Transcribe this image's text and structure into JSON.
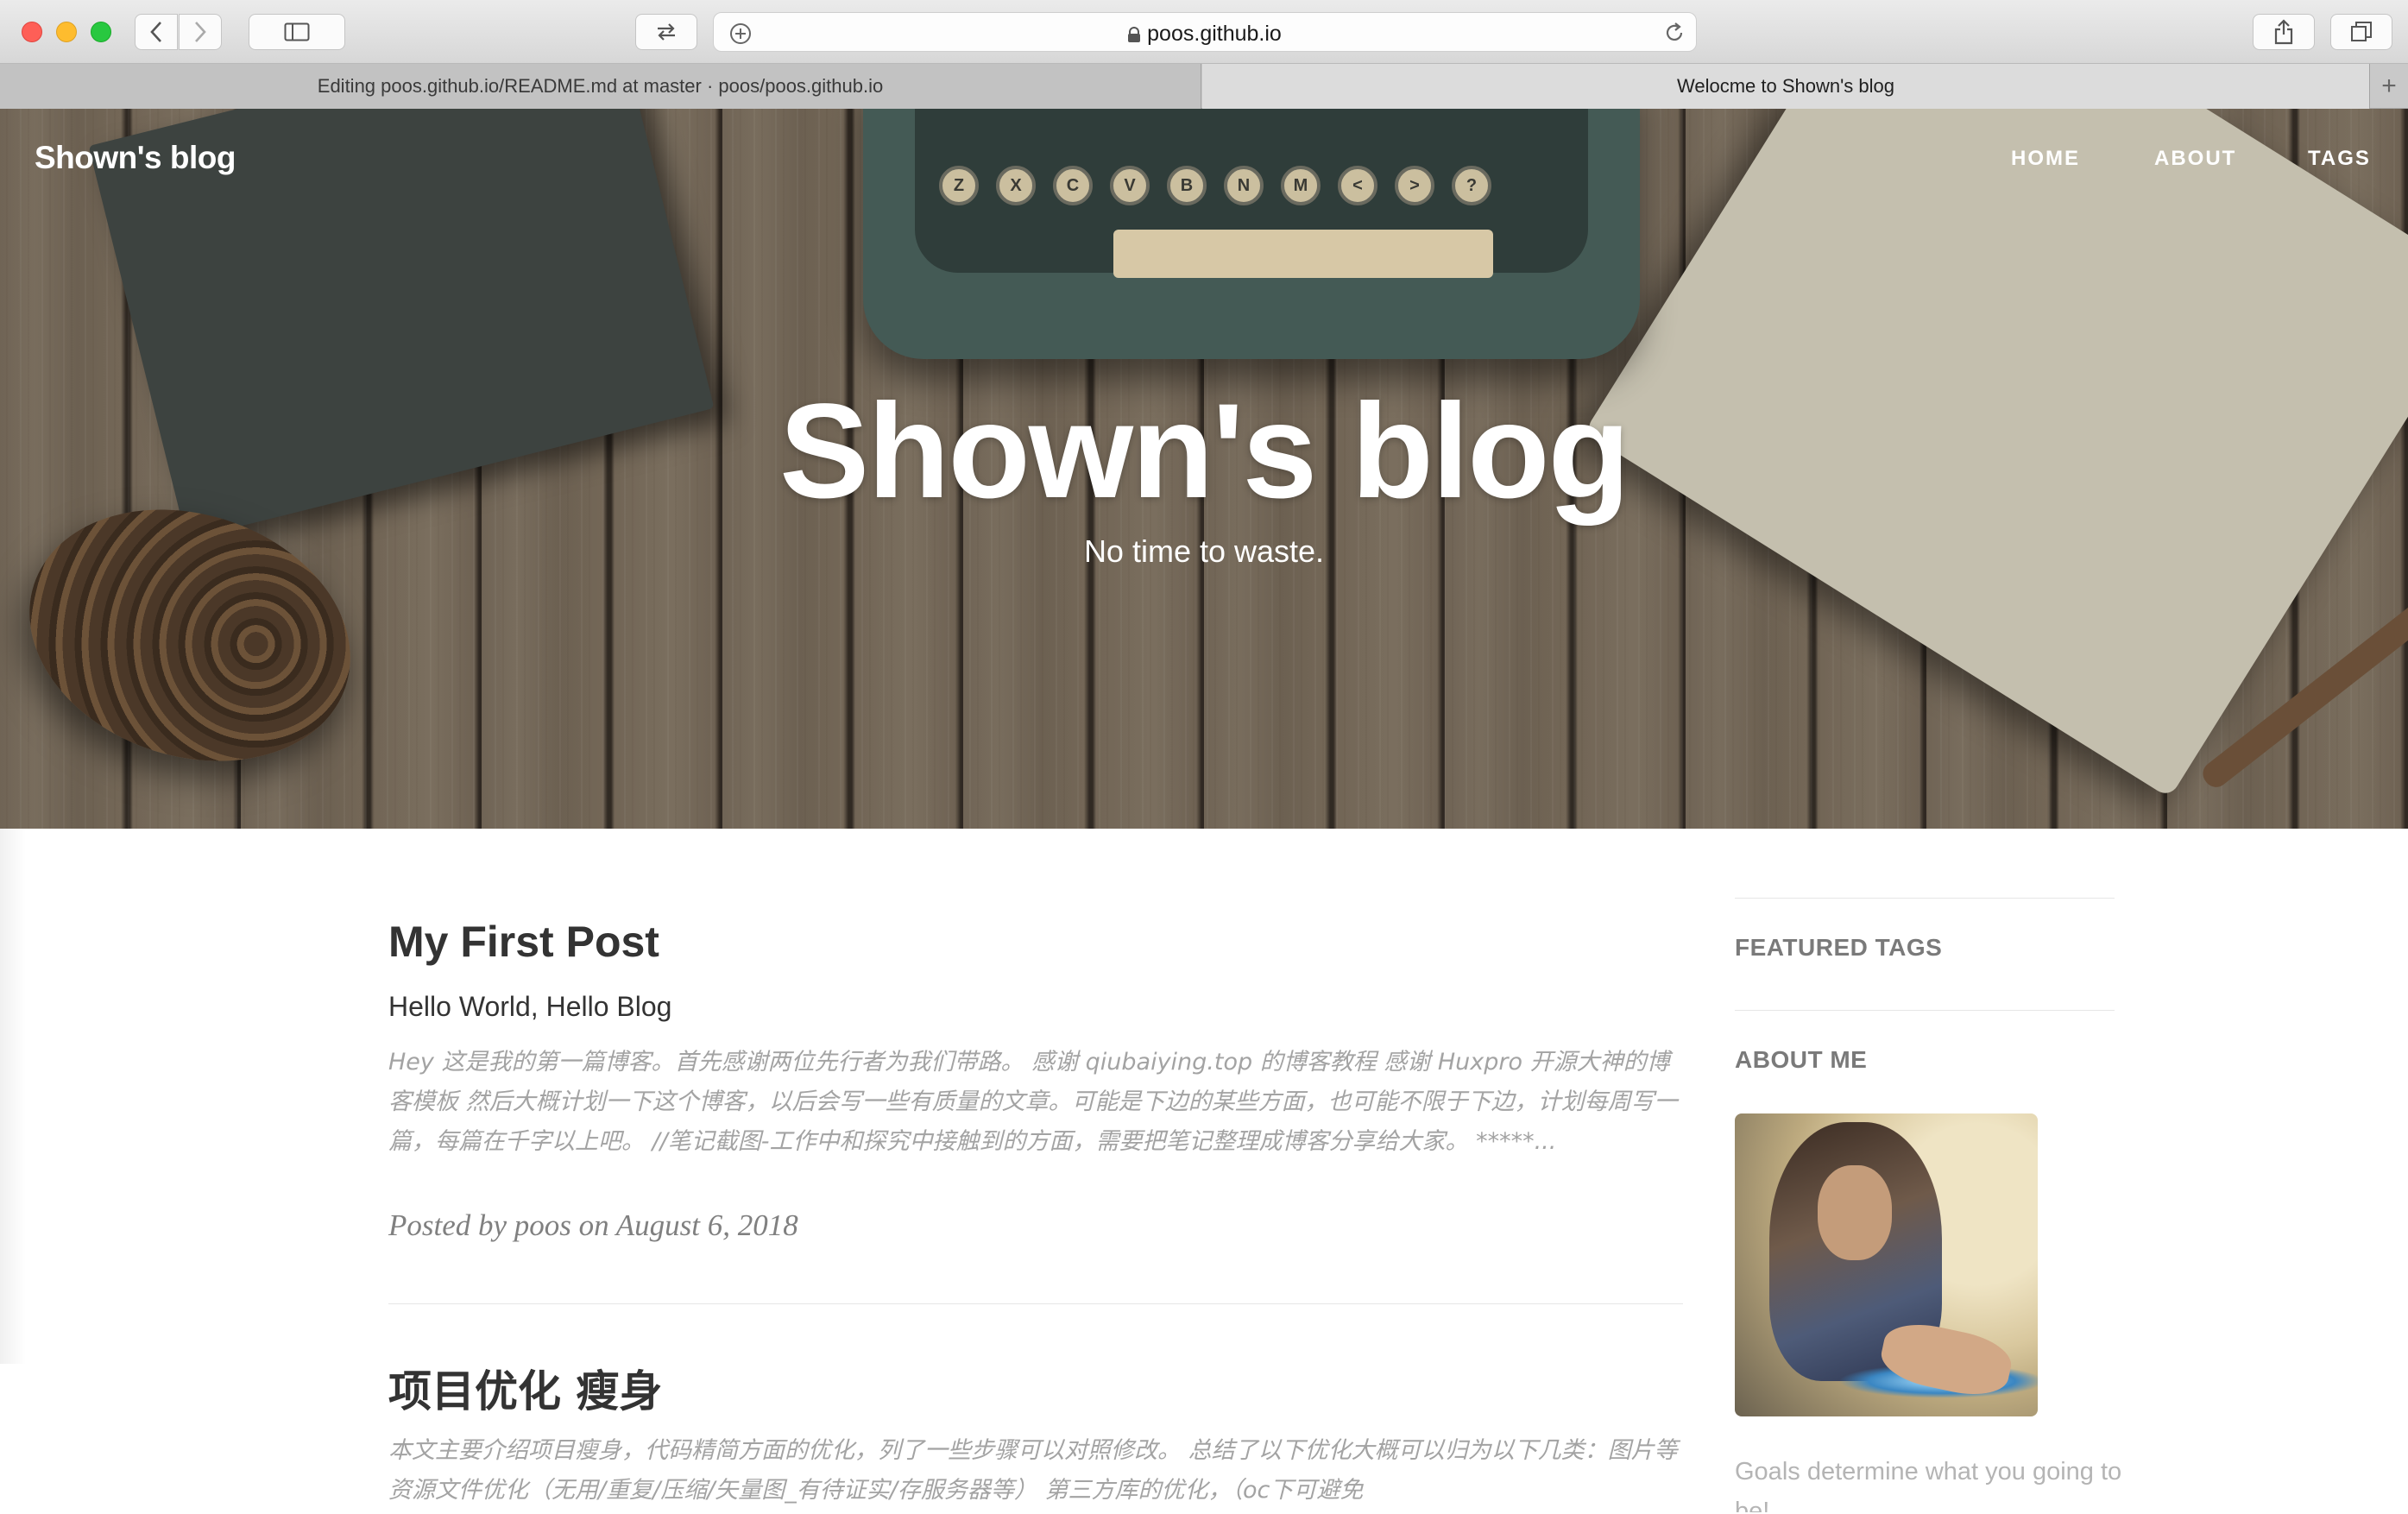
{
  "browser": {
    "url": "poos.github.io",
    "tabs": [
      {
        "label": "Editing poos.github.io/README.md at master · poos/poos.github.io",
        "active": false
      },
      {
        "label": "Welocme to Shown's blog",
        "active": true
      }
    ],
    "new_tab_label": "+"
  },
  "site": {
    "brand": "Shown's blog",
    "nav": [
      "HOME",
      "ABOUT",
      "TAGS"
    ],
    "hero_title": "Shown's blog",
    "hero_subtitle": "No time to waste.",
    "typewriter_keys": [
      "Z",
      "X",
      "C",
      "V",
      "B",
      "N",
      "M",
      "<",
      ">",
      "?"
    ]
  },
  "posts": [
    {
      "title": "My First Post",
      "subtitle": "Hello World, Hello Blog",
      "excerpt": "Hey 这是我的第一篇博客。首先感谢两位先行者为我们带路。 感谢 qiubaiying.top 的博客教程 感谢 Huxpro 开源大神的博客模板 然后大概计划一下这个博客，以后会写一些有质量的文章。可能是下边的某些方面，也可能不限于下边，计划每周写一篇，每篇在千字以上吧。 //笔记截图-工作中和探究中接触到的方面，需要把笔记整理成博客分享给大家。 *****...",
      "meta": "Posted by poos on August 6, 2018"
    },
    {
      "title": "项目优化 瘦身",
      "excerpt": "本文主要介绍项目瘦身，代码精简方面的优化，列了一些步骤可以对照修改。 总结了以下优化大概可以归为以下几类：图片等资源文件优化（无用/重复/压缩/矢量图_有待证实/存服务器等） 第三方库的优化，（oc下可避免"
    }
  ],
  "sidebar": {
    "featured_tags_heading": "FEATURED TAGS",
    "about_heading": "ABOUT ME",
    "about_text": "Goals determine what you going to be!"
  },
  "colors": {
    "close": "#fe5f57",
    "minimize": "#febc2e",
    "zoom": "#28c840"
  }
}
